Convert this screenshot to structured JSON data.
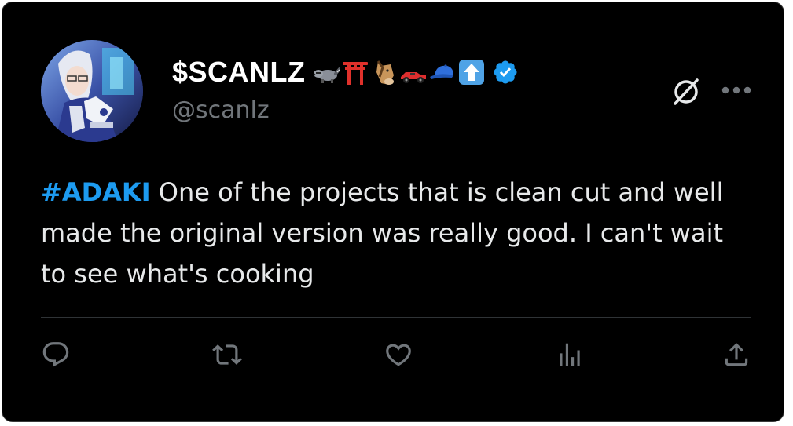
{
  "tweet": {
    "author": {
      "display_name": "$SCANLZ",
      "handle": "@scanlz",
      "name_emojis": [
        "raccoon-emoji",
        "torii-gate-emoji",
        "horse-face-emoji",
        "race-car-emoji",
        "billed-cap-emoji",
        "up-arrow-emoji"
      ],
      "verified": true,
      "verified_color": "#1d9bf0"
    },
    "hashtag": "#ADAKI",
    "text": " One of the projects that is clean cut and well made the original version was really good. I can't wait to see what's cooking",
    "accent_color": "#1d9bf0"
  },
  "actions": {
    "reply": "reply-icon",
    "retweet": "retweet-icon",
    "like": "heart-icon",
    "views": "views-bar-chart-icon",
    "share": "share-icon"
  },
  "header_icons": {
    "grok": "grok-slash-circle-icon",
    "more": "more-dots-icon"
  }
}
